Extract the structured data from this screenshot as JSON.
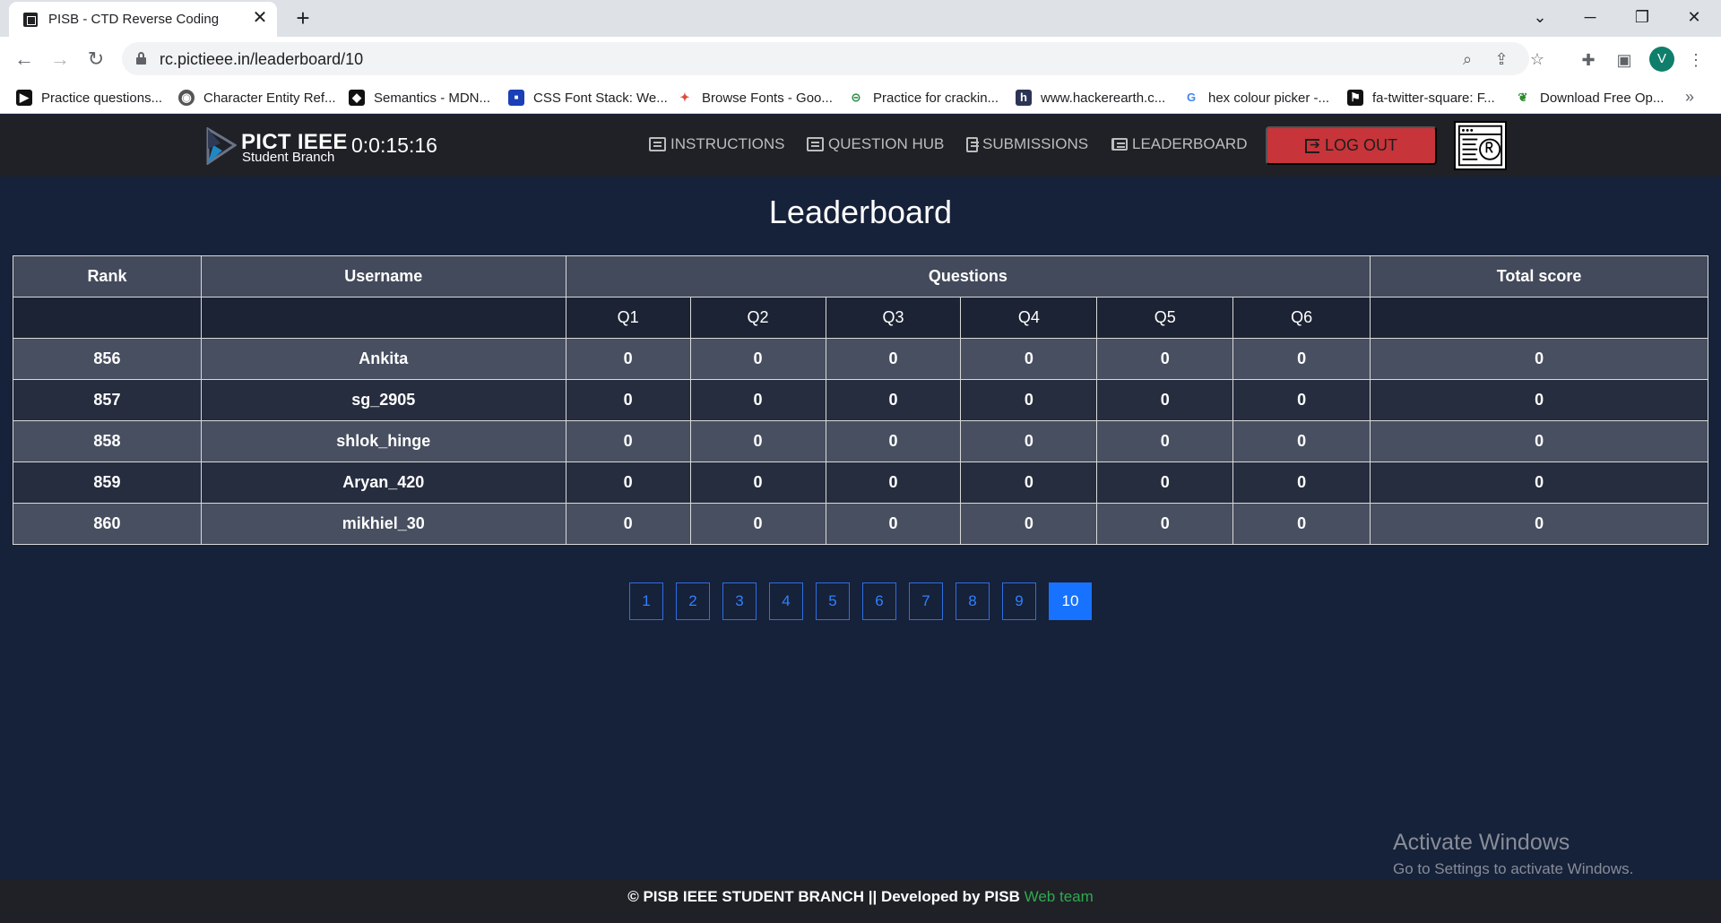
{
  "browser": {
    "tab_title": "PISB - CTD Reverse Coding",
    "url": "rc.pictieee.in/leaderboard/10",
    "avatar_letter": "V",
    "bookmarks": [
      {
        "label": "Practice questions...",
        "icon": "play-icon"
      },
      {
        "label": "Character Entity Ref...",
        "icon": "globe-icon"
      },
      {
        "label": "Semantics - MDN...",
        "icon": "mdn-icon"
      },
      {
        "label": "CSS Font Stack: We...",
        "icon": "cssfont-icon"
      },
      {
        "label": "Browse Fonts - Goo...",
        "icon": "googlefonts-icon"
      },
      {
        "label": "Practice for crackin...",
        "icon": "geeks-icon"
      },
      {
        "label": "www.hackerearth.c...",
        "icon": "hackerearth-icon"
      },
      {
        "label": "hex colour picker -...",
        "icon": "google-icon"
      },
      {
        "label": "fa-twitter-square: F...",
        "icon": "flag-icon"
      },
      {
        "label": "Download Free Op...",
        "icon": "leaf-icon"
      }
    ]
  },
  "header": {
    "logo_title": "PICT IEEE",
    "logo_subtitle": "Student Branch",
    "timer": "0:0:15:16",
    "nav": {
      "instructions": "INSTRUCTIONS",
      "question_hub": "QUESTION HUB",
      "submissions": "SUBMISSIONS",
      "leaderboard": "LEADERBOARD"
    },
    "logout_label": "LOG OUT"
  },
  "leaderboard": {
    "title": "Leaderboard",
    "columns": {
      "rank": "Rank",
      "username": "Username",
      "questions": "Questions",
      "total": "Total score"
    },
    "question_labels": [
      "Q1",
      "Q2",
      "Q3",
      "Q4",
      "Q5",
      "Q6"
    ],
    "rows": [
      {
        "rank": "856",
        "username": "Ankita",
        "scores": [
          "0",
          "0",
          "0",
          "0",
          "0",
          "0"
        ],
        "total": "0"
      },
      {
        "rank": "857",
        "username": "sg_2905",
        "scores": [
          "0",
          "0",
          "0",
          "0",
          "0",
          "0"
        ],
        "total": "0"
      },
      {
        "rank": "858",
        "username": "shlok_hinge",
        "scores": [
          "0",
          "0",
          "0",
          "0",
          "0",
          "0"
        ],
        "total": "0"
      },
      {
        "rank": "859",
        "username": "Aryan_420",
        "scores": [
          "0",
          "0",
          "0",
          "0",
          "0",
          "0"
        ],
        "total": "0"
      },
      {
        "rank": "860",
        "username": "mikhiel_30",
        "scores": [
          "0",
          "0",
          "0",
          "0",
          "0",
          "0"
        ],
        "total": "0"
      }
    ],
    "pages": [
      "1",
      "2",
      "3",
      "4",
      "5",
      "6",
      "7",
      "8",
      "9",
      "10"
    ],
    "current_page": "10"
  },
  "watermark": {
    "title": "Activate Windows",
    "subtitle": "Go to Settings to activate Windows."
  },
  "footer": {
    "text": "© PISB IEEE STUDENT BRANCH || Developed by PISB ",
    "accent": "Web team"
  },
  "colors": {
    "page_bg": "#16213a",
    "header_bg": "#1f2126",
    "logout": "#c7343a",
    "active_page": "#1773ff",
    "footer_accent": "#2eaa4f"
  }
}
